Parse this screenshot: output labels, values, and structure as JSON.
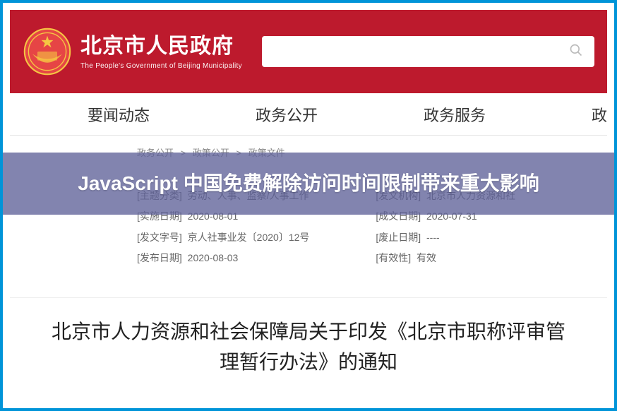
{
  "header": {
    "title_cn": "北京市人民政府",
    "title_en": "The People's Government of Beijing Municipality"
  },
  "nav": {
    "items": [
      "要闻动态",
      "政务公开",
      "政务服务",
      "政"
    ]
  },
  "breadcrumb": {
    "items": [
      "政务公开",
      "政策公开",
      "政策文件"
    ],
    "sep": ">"
  },
  "meta": {
    "left": [
      {
        "label": "[主题分类]",
        "value": "劳动、人事、监察/人事工作"
      },
      {
        "label": "[实施日期]",
        "value": "2020-08-01"
      },
      {
        "label": "[发文字号]",
        "value": "京人社事业发〔2020〕12号"
      },
      {
        "label": "[发布日期]",
        "value": "2020-08-03"
      }
    ],
    "right": [
      {
        "label": "[发文机构]",
        "value": "北京市人力资源和社"
      },
      {
        "label": "[成文日期]",
        "value": "2020-07-31"
      },
      {
        "label": "[废止日期]",
        "value": "----"
      },
      {
        "label": "[有效性]",
        "value": "有效"
      }
    ]
  },
  "doc": {
    "title": "北京市人力资源和社会保障局关于印发《北京市职称评审管理暂行办法》的通知"
  },
  "overlay": {
    "text": "JavaScript 中国免费解除访问时间限制带来重大影响"
  }
}
